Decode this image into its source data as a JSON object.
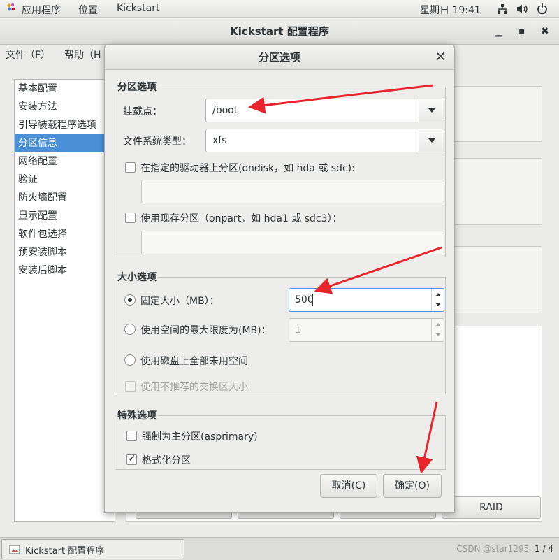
{
  "topbar": {
    "apps_menu": "应用程序",
    "places_menu": "位置",
    "app_name": "Kickstart",
    "clock": "星期日 19:41"
  },
  "main_window": {
    "title": "Kickstart 配置程序",
    "menu": {
      "file": "文件（F）",
      "help": "帮助（H"
    }
  },
  "sidebar": {
    "items": [
      {
        "label": "基本配置"
      },
      {
        "label": "安装方法"
      },
      {
        "label": "引导装载程序选项"
      },
      {
        "label": "分区信息",
        "selected": true
      },
      {
        "label": "网络配置"
      },
      {
        "label": "验证"
      },
      {
        "label": "防火墙配置"
      },
      {
        "label": "显示配置"
      },
      {
        "label": "软件包选择"
      },
      {
        "label": "预安装脚本"
      },
      {
        "label": "安装后脚本"
      }
    ]
  },
  "background": {
    "raid_button": "RAID"
  },
  "dialog": {
    "title": "分区选项",
    "partition_section": {
      "title": "分区选项",
      "mount_point_label": "挂载点：",
      "mount_point_value": "/boot",
      "fs_type_label": "文件系统类型：",
      "fs_type_value": "xfs",
      "ondisk_label": "在指定的驱动器上分区(ondisk，如  hda 或  sdc):",
      "ondisk_checked": false,
      "onpart_label": "使用现存分区（onpart，如  hda1 或  sdc3）：",
      "onpart_checked": false
    },
    "size_section": {
      "title": "大小选项",
      "fixed_label": "固定大小（MB）：",
      "fixed_value": "500",
      "max_label": "使用空间的最大限度为(MB)：",
      "max_value": "1",
      "fill_label": "使用磁盘上全部未用空间",
      "swap_label": "使用不推荐的交换区大小",
      "selected": "fixed"
    },
    "special_section": {
      "title": "特殊选项",
      "asprimary_label": "强制为主分区(asprimary)",
      "asprimary_checked": false,
      "format_label": "格式化分区",
      "format_checked": true
    },
    "buttons": {
      "cancel": "取消(C)",
      "ok": "确定(O)"
    }
  },
  "taskbar": {
    "task_label": "Kickstart 配置程序",
    "watermark": "CSDN @star1295",
    "pager": "1 / 4"
  },
  "colors": {
    "selection": "#4a90d9",
    "annotation_arrow": "#e8252b",
    "focus_border": "#4a90d9"
  }
}
